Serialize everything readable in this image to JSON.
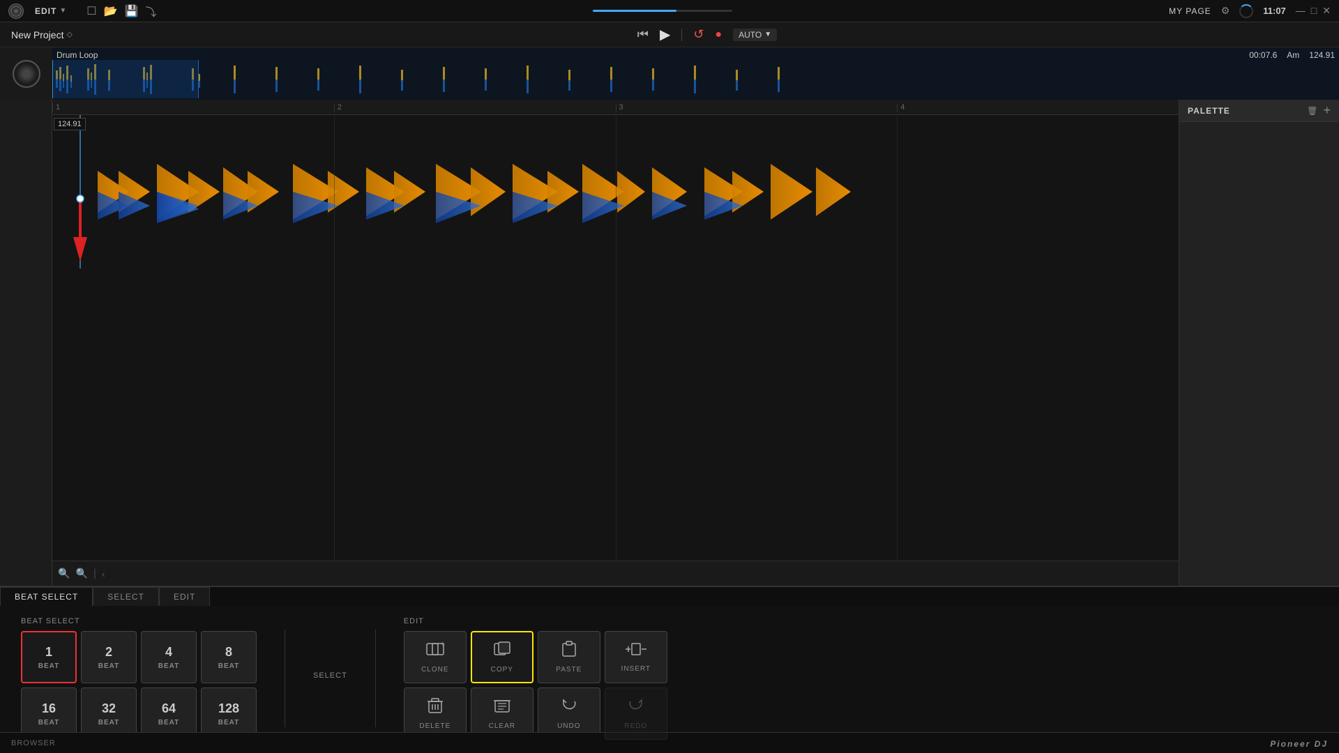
{
  "app": {
    "title": "New Project",
    "logo": "⊙"
  },
  "topbar": {
    "menu_label": "EDIT",
    "my_page": "MY PAGE",
    "time": "11:07",
    "window_min": "—",
    "window_max": "□",
    "window_close": "✕"
  },
  "transport": {
    "skip_back": "⏮",
    "play": "▶",
    "loop": "↺",
    "record_dot": "●",
    "auto_label": "AUTO",
    "time_display": "00:07.6",
    "key_display": "Am",
    "bpm_display": "124.91"
  },
  "overview": {
    "title": "Drum Loop",
    "time": "00:07.6",
    "key": "Am",
    "bpm": "124.91"
  },
  "timeline": {
    "bpm_label": "124.91",
    "marks": [
      "1",
      "2",
      "3",
      "4"
    ]
  },
  "palette": {
    "title": "PALETTE",
    "add_btn": "+"
  },
  "beat_select": {
    "section_label": "BEAT SELECT",
    "beats": [
      {
        "value": "1",
        "label": "BEAT",
        "selected": true
      },
      {
        "value": "2",
        "label": "BEAT",
        "selected": false
      },
      {
        "value": "4",
        "label": "BEAT",
        "selected": false
      },
      {
        "value": "8",
        "label": "BEAT",
        "selected": false
      },
      {
        "value": "16",
        "label": "BEAT",
        "selected": false
      },
      {
        "value": "32",
        "label": "BEAT",
        "selected": false
      },
      {
        "value": "64",
        "label": "BEAT",
        "selected": false
      },
      {
        "value": "128",
        "label": "BEAT",
        "selected": false
      }
    ]
  },
  "select_section": {
    "label": "SELECT"
  },
  "edit_section": {
    "label": "EDIT",
    "buttons": [
      {
        "id": "clone",
        "icon": "⊞+",
        "label": "CLONE",
        "highlighted": false,
        "disabled": false
      },
      {
        "id": "copy",
        "icon": "⧉",
        "label": "COPY",
        "highlighted": true,
        "disabled": false
      },
      {
        "id": "paste",
        "icon": "▣",
        "label": "PASTE",
        "highlighted": false,
        "disabled": false
      },
      {
        "id": "insert",
        "icon": "⊟+",
        "label": "INSERT",
        "highlighted": false,
        "disabled": false
      },
      {
        "id": "delete",
        "icon": "🗑",
        "label": "DELETE",
        "highlighted": false,
        "disabled": false
      },
      {
        "id": "clear",
        "icon": "⊟",
        "label": "CLEAR",
        "highlighted": false,
        "disabled": false
      },
      {
        "id": "undo",
        "icon": "↩",
        "label": "UNDO",
        "highlighted": false,
        "disabled": false
      },
      {
        "id": "redo",
        "icon": "↪",
        "label": "REDO",
        "highlighted": false,
        "disabled": true
      }
    ]
  },
  "tabs": [
    {
      "id": "beat-select",
      "label": "BEAT SELECT",
      "active": true
    },
    {
      "id": "select",
      "label": "SELECT",
      "active": false
    },
    {
      "id": "edit",
      "label": "EDIT",
      "active": false
    }
  ],
  "browser": {
    "label": "BROWSER",
    "pioneer_logo": "Pioneer DJ"
  }
}
